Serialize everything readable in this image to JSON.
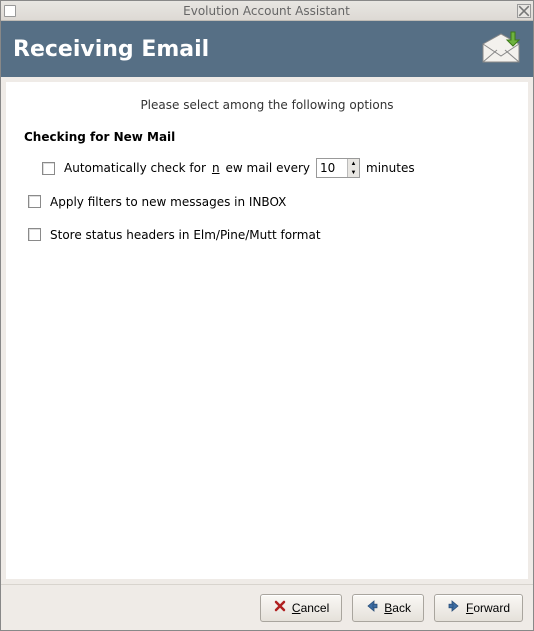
{
  "window": {
    "title": "Evolution Account Assistant"
  },
  "header": {
    "title": "Receiving Email"
  },
  "content": {
    "instruction": "Please select among the following options",
    "section_heading": "Checking for New Mail",
    "auto_check": {
      "label_prefix": "Automatically check for ",
      "label_mnemonic": "n",
      "label_mid": "ew mail every",
      "value": "10",
      "label_suffix": "minutes"
    },
    "apply_filters_label": "Apply filters to new messages in INBOX",
    "store_status_label": "Store status headers in Elm/Pine/Mutt format"
  },
  "buttons": {
    "cancel": "Cancel",
    "back": "Back",
    "forward": "Forward"
  }
}
